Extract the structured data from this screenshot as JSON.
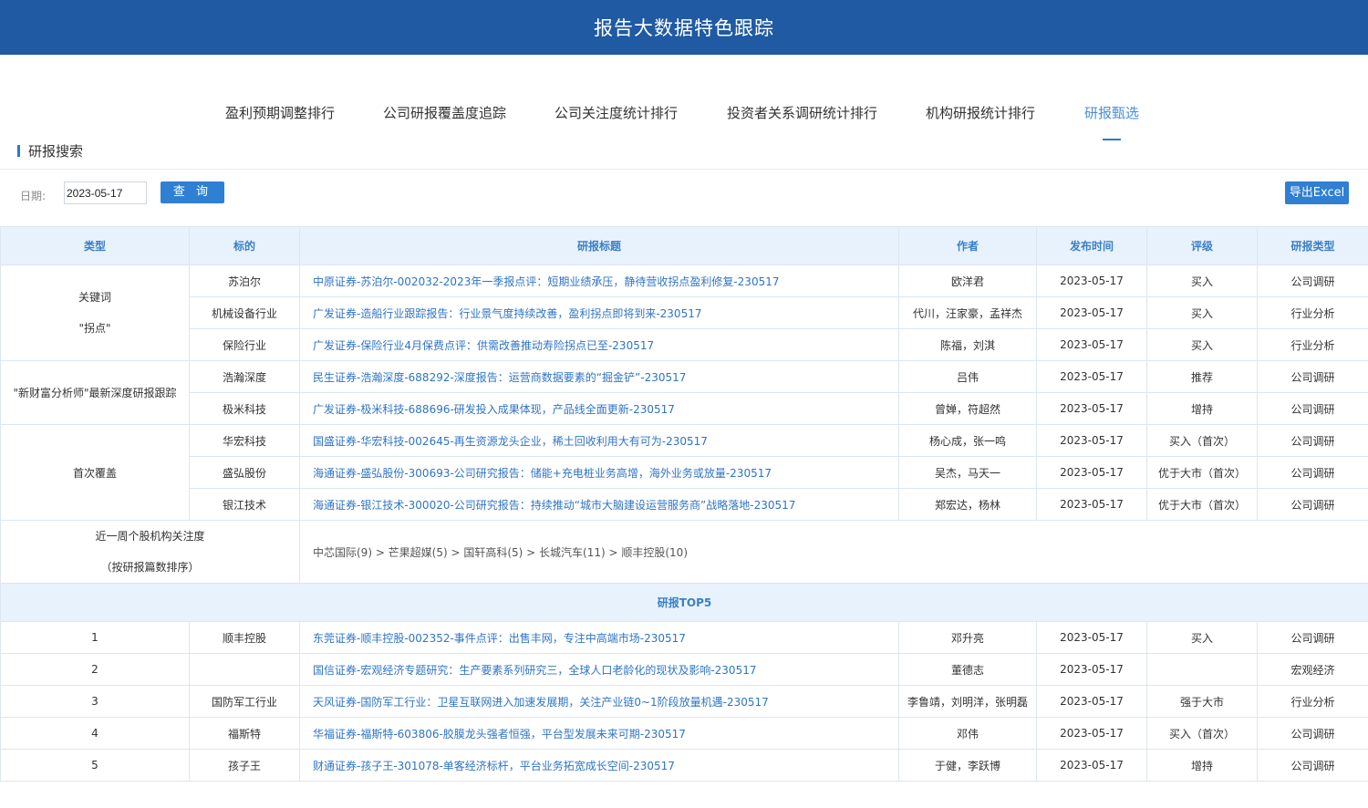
{
  "header": {
    "title": "报告大数据特色跟踪"
  },
  "tabs": [
    {
      "label": "盈利预期调整排行"
    },
    {
      "label": "公司研报覆盖度追踪"
    },
    {
      "label": "公司关注度统计排行"
    },
    {
      "label": "投资者关系调研统计排行"
    },
    {
      "label": "机构研报统计排行"
    },
    {
      "label": "研报甄选",
      "active": true
    }
  ],
  "section": {
    "title": "研报搜索"
  },
  "search": {
    "date_label": "日期:",
    "date_value": "2023-05-17",
    "query_label": "查 询",
    "export_label": "导出Excel"
  },
  "table": {
    "headers": [
      "类型",
      "标的",
      "研报标题",
      "作者",
      "发布时间",
      "评级",
      "研报类型"
    ],
    "groups": [
      {
        "type_lines": [
          "关键词",
          "\"拐点\""
        ],
        "rows": [
          {
            "target": "苏泊尔",
            "title": "中原证券-苏泊尔-002032-2023年一季报点评：短期业绩承压，静待营收拐点盈利修复-230517",
            "author": "欧洋君",
            "date": "2023-05-17",
            "rating": "买入",
            "report_type": "公司调研"
          },
          {
            "target": "机械设备行业",
            "title": "广发证券-造船行业跟踪报告：行业景气度持续改善，盈利拐点即将到来-230517",
            "author": "代川，汪家豪，孟祥杰",
            "date": "2023-05-17",
            "rating": "买入",
            "report_type": "行业分析"
          },
          {
            "target": "保险行业",
            "title": "广发证券-保险行业4月保费点评：供需改善推动寿险拐点已至-230517",
            "author": "陈福，刘淇",
            "date": "2023-05-17",
            "rating": "买入",
            "report_type": "行业分析"
          }
        ]
      },
      {
        "type_lines": [
          "\"新财富分析师\"最新深度研报跟踪"
        ],
        "rows": [
          {
            "target": "浩瀚深度",
            "title": "民生证券-浩瀚深度-688292-深度报告：运营商数据要素的“掘金铲”-230517",
            "author": "吕伟",
            "date": "2023-05-17",
            "rating": "推荐",
            "report_type": "公司调研"
          },
          {
            "target": "极米科技",
            "title": "广发证券-极米科技-688696-研发投入成果体现，产品线全面更新-230517",
            "author": "曾婵，符超然",
            "date": "2023-05-17",
            "rating": "增持",
            "report_type": "公司调研"
          }
        ]
      },
      {
        "type_lines": [
          "首次覆盖"
        ],
        "rows": [
          {
            "target": "华宏科技",
            "title": "国盛证券-华宏科技-002645-再生资源龙头企业，稀土回收利用大有可为-230517",
            "author": "杨心成，张一鸣",
            "date": "2023-05-17",
            "rating": "买入（首次）",
            "report_type": "公司调研"
          },
          {
            "target": "盛弘股份",
            "title": "海通证券-盛弘股份-300693-公司研究报告：储能+充电桩业务高增，海外业务或放量-230517",
            "author": "吴杰，马天一",
            "date": "2023-05-17",
            "rating": "优于大市（首次）",
            "report_type": "公司调研"
          },
          {
            "target": "银江技术",
            "title": "海通证券-银江技术-300020-公司研究报告：持续推动“城市大脑建设运营服务商”战略落地-230517",
            "author": "郑宏达，杨林",
            "date": "2023-05-17",
            "rating": "优于大市（首次）",
            "report_type": "公司调研"
          }
        ]
      }
    ],
    "focus": {
      "label_lines": [
        "近一周个股机构关注度",
        "（按研报篇数排序）"
      ],
      "chain": "中芯国际(9) > 芒果超媒(5) > 国轩高科(5) > 长城汽车(11) > 顺丰控股(10)"
    },
    "top5_label": "研报TOP5",
    "top5": [
      {
        "rank": "1",
        "target": "顺丰控股",
        "title": "东莞证券-顺丰控股-002352-事件点评：出售丰网，专注中高端市场-230517",
        "author": "邓升亮",
        "date": "2023-05-17",
        "rating": "买入",
        "report_type": "公司调研"
      },
      {
        "rank": "2",
        "target": "",
        "title": "国信证券-宏观经济专题研究：生产要素系列研究三，全球人口老龄化的现状及影响-230517",
        "author": "董德志",
        "date": "2023-05-17",
        "rating": "",
        "report_type": "宏观经济"
      },
      {
        "rank": "3",
        "target": "国防军工行业",
        "title": "天风证券-国防军工行业：卫星互联网进入加速发展期，关注产业链0~1阶段放量机遇-230517",
        "author": "李鲁靖，刘明洋，张明磊",
        "date": "2023-05-17",
        "rating": "强于大市",
        "report_type": "行业分析"
      },
      {
        "rank": "4",
        "target": "福斯特",
        "title": "华福证券-福斯特-603806-胶膜龙头强者恒强，平台型发展未来可期-230517",
        "author": "邓伟",
        "date": "2023-05-17",
        "rating": "买入（首次）",
        "report_type": "公司调研"
      },
      {
        "rank": "5",
        "target": "孩子王",
        "title": "财通证券-孩子王-301078-单客经济标杆，平台业务拓宽成长空间-230517",
        "author": "于健，李跃博",
        "date": "2023-05-17",
        "rating": "增持",
        "report_type": "公司调研"
      }
    ]
  },
  "colors": {
    "header_bg": "#1f5aa3",
    "accent": "#2f7fd3",
    "link": "#2f74c4",
    "table_head_bg": "#e8f2fc"
  }
}
